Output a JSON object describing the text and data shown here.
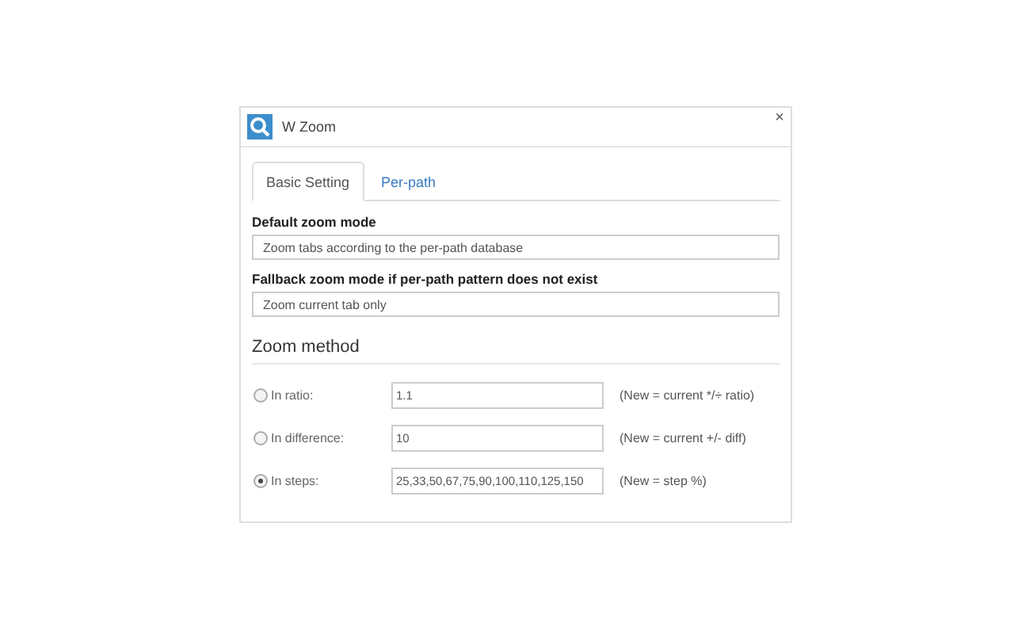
{
  "window": {
    "title": "W Zoom",
    "close": "×"
  },
  "tabs": [
    {
      "label": "Basic Setting",
      "selected": true
    },
    {
      "label": "Per-path",
      "selected": false
    }
  ],
  "settings": [
    {
      "label": "Default zoom mode",
      "value": "Zoom tabs according to the per-path database"
    },
    {
      "label": "Fallback zoom mode if per-path pattern does not exist",
      "value": "Zoom current tab only"
    }
  ],
  "zoom_method": {
    "heading": "Zoom method",
    "options": [
      {
        "label": "In ratio:",
        "value": "1.1",
        "hint": "(New = current */÷ ratio)",
        "selected": false
      },
      {
        "label": "In difference:",
        "value": "10",
        "hint": "(New = current +/- diff)",
        "selected": false
      },
      {
        "label": "In steps:",
        "value": "25,33,50,67,75,90,100,110,125,150",
        "hint": "(New = step %)",
        "selected": true
      }
    ]
  }
}
